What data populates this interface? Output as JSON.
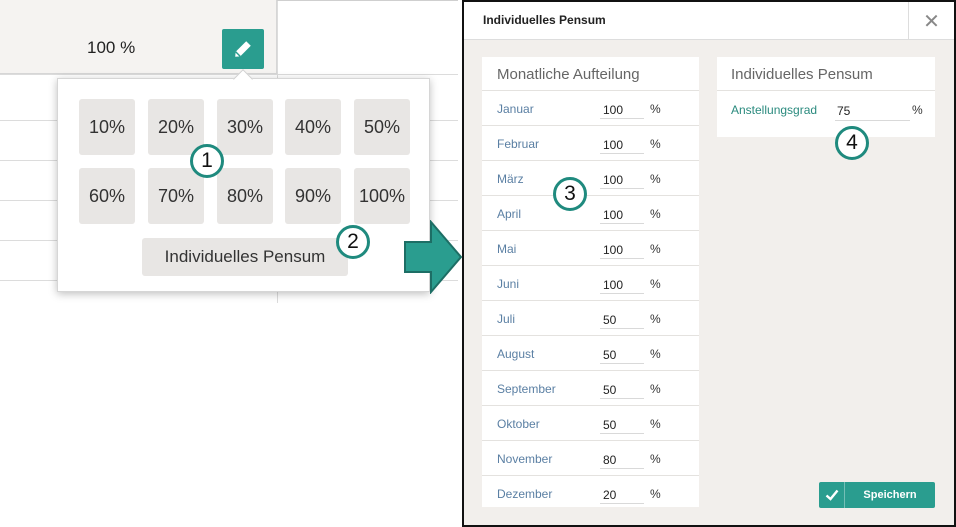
{
  "left": {
    "cell_value": "100 %",
    "percent_options": [
      "10%",
      "20%",
      "30%",
      "40%",
      "50%",
      "60%",
      "70%",
      "80%",
      "90%",
      "100%"
    ],
    "individual_button": "Individuelles Pensum"
  },
  "badges": [
    "1",
    "2",
    "3",
    "4"
  ],
  "modal": {
    "title": "Individuelles Pensum",
    "close_symbol": "✕",
    "monthly": {
      "title": "Monatliche Aufteilung",
      "unit": "%",
      "months": [
        {
          "label": "Januar",
          "value": "100"
        },
        {
          "label": "Februar",
          "value": "100"
        },
        {
          "label": "März",
          "value": "100"
        },
        {
          "label": "April",
          "value": "100"
        },
        {
          "label": "Mai",
          "value": "100"
        },
        {
          "label": "Juni",
          "value": "100"
        },
        {
          "label": "Juli",
          "value": "50"
        },
        {
          "label": "August",
          "value": "50"
        },
        {
          "label": "September",
          "value": "50"
        },
        {
          "label": "Oktober",
          "value": "50"
        },
        {
          "label": "November",
          "value": "80"
        },
        {
          "label": "Dezember",
          "value": "20"
        }
      ]
    },
    "individual": {
      "title": "Individuelles Pensum",
      "field_label": "Anstellungsgrad",
      "field_value": "75",
      "unit": "%"
    },
    "save_label": "Speichern"
  },
  "colors": {
    "accent": "#2a9d8f",
    "badge_ring": "#1f8a7e",
    "modal_bg": "#f2efec",
    "label_blue": "#5a7fa3"
  },
  "icons": {
    "edit": "pencil-icon",
    "close": "close-icon",
    "save": "check-icon",
    "arrow": "arrow-right-icon"
  }
}
